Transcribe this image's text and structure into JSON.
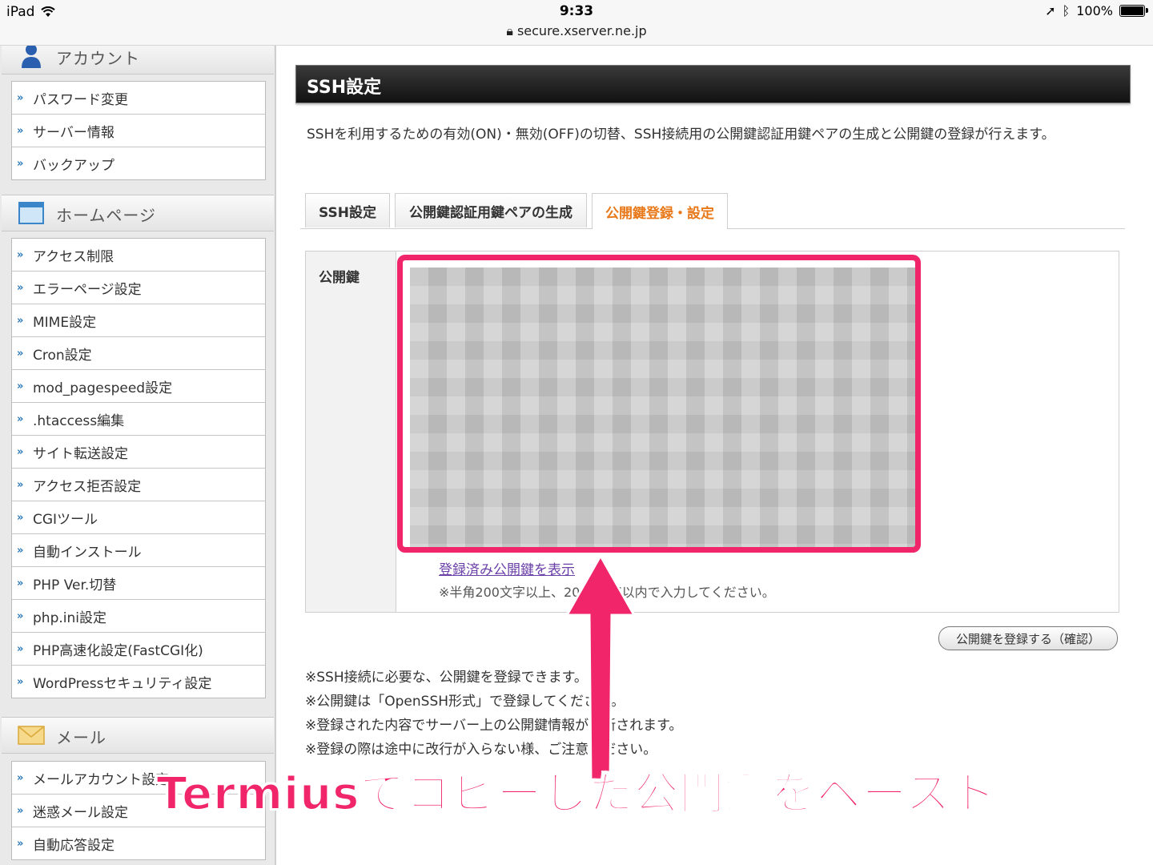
{
  "status_bar": {
    "device": "iPad",
    "time": "9:33",
    "url": "secure.xserver.ne.jp",
    "battery": "100%",
    "battery_level": 1.0
  },
  "sidebar": {
    "account": {
      "title": "アカウント",
      "items": [
        "パスワード変更",
        "サーバー情報",
        "バックアップ"
      ]
    },
    "homepage": {
      "title": "ホームページ",
      "items": [
        "アクセス制限",
        "エラーページ設定",
        "MIME設定",
        "Cron設定",
        "mod_pagespeed設定",
        ".htaccess編集",
        "サイト転送設定",
        "アクセス拒否設定",
        "CGIツール",
        "自動インストール",
        "PHP Ver.切替",
        "php.ini設定",
        "PHP高速化設定(FastCGI化)",
        "WordPressセキュリティ設定"
      ]
    },
    "mail": {
      "title": "メール",
      "items": [
        "メールアカウント設定",
        "迷惑メール設定",
        "自動応答設定"
      ]
    }
  },
  "main": {
    "title": "SSH設定",
    "description": "SSHを利用するための有効(ON)・無効(OFF)の切替、SSH接続用の公開鍵認証用鍵ペアの生成と公開鍵の登録が行えます。",
    "tabs": [
      {
        "label": "SSH設定",
        "active": false
      },
      {
        "label": "公開鍵認証用鍵ペアの生成",
        "active": false
      },
      {
        "label": "公開鍵登録・設定",
        "active": true
      }
    ],
    "form": {
      "label": "公開鍵",
      "link": "登録済み公開鍵を表示",
      "hint": "※半角200文字以上、2000文字以内で入力してください。"
    },
    "confirm_button": "公開鍵を登録する（確認）",
    "notes": [
      "※SSH接続に必要な、公開鍵を登録できます。",
      "※公開鍵は「OpenSSH形式」で登録してください。",
      "※登録された内容でサーバー上の公開鍵情報が更新されます。",
      "※登録の際は途中に改行が入らない様、ご注意ください。"
    ]
  },
  "annotation": {
    "caption": "Termiusでコピーした公開鍵をペースト",
    "color": "#f0256a"
  },
  "colors": {
    "active_tab": "#e8791a",
    "link": "#6a3fa8",
    "menu_arrow": "#2a79b8"
  }
}
